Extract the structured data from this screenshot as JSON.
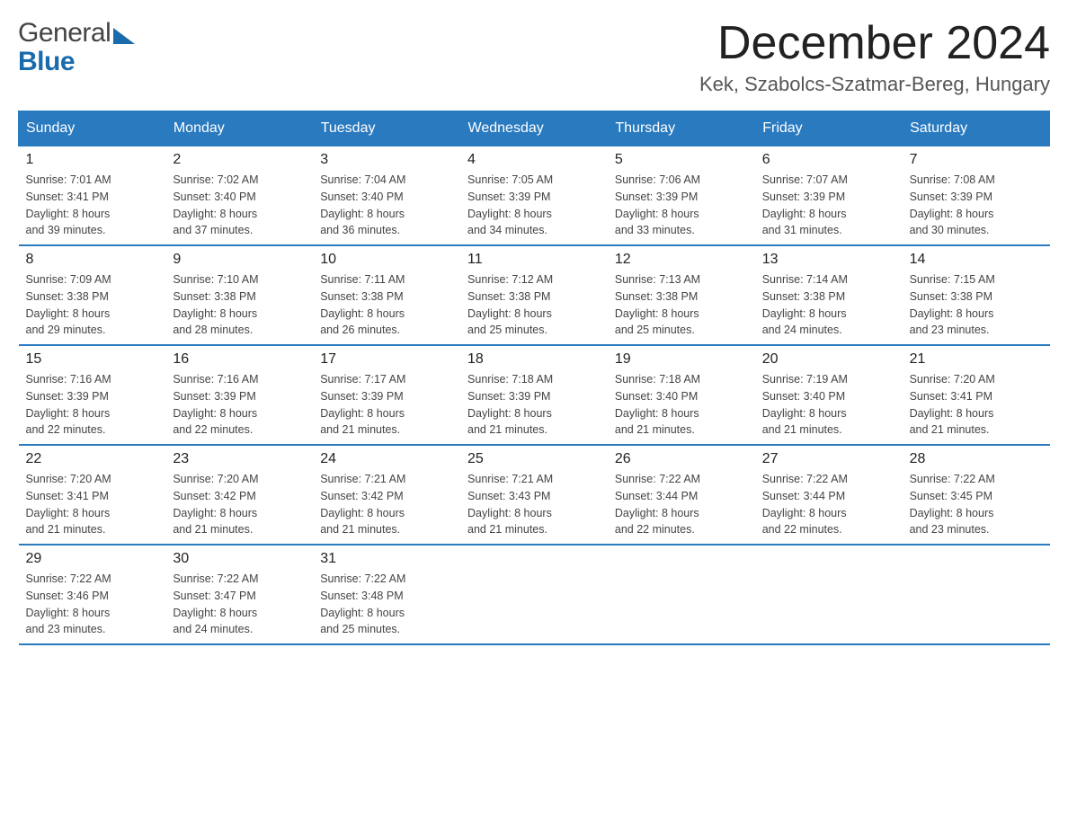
{
  "header": {
    "logo_general": "General",
    "logo_blue": "Blue",
    "month_title": "December 2024",
    "location": "Kek, Szabolcs-Szatmar-Bereg, Hungary"
  },
  "weekdays": [
    "Sunday",
    "Monday",
    "Tuesday",
    "Wednesday",
    "Thursday",
    "Friday",
    "Saturday"
  ],
  "weeks": [
    [
      {
        "day": "1",
        "sunrise": "7:01 AM",
        "sunset": "3:41 PM",
        "daylight": "8 hours and 39 minutes."
      },
      {
        "day": "2",
        "sunrise": "7:02 AM",
        "sunset": "3:40 PM",
        "daylight": "8 hours and 37 minutes."
      },
      {
        "day": "3",
        "sunrise": "7:04 AM",
        "sunset": "3:40 PM",
        "daylight": "8 hours and 36 minutes."
      },
      {
        "day": "4",
        "sunrise": "7:05 AM",
        "sunset": "3:39 PM",
        "daylight": "8 hours and 34 minutes."
      },
      {
        "day": "5",
        "sunrise": "7:06 AM",
        "sunset": "3:39 PM",
        "daylight": "8 hours and 33 minutes."
      },
      {
        "day": "6",
        "sunrise": "7:07 AM",
        "sunset": "3:39 PM",
        "daylight": "8 hours and 31 minutes."
      },
      {
        "day": "7",
        "sunrise": "7:08 AM",
        "sunset": "3:39 PM",
        "daylight": "8 hours and 30 minutes."
      }
    ],
    [
      {
        "day": "8",
        "sunrise": "7:09 AM",
        "sunset": "3:38 PM",
        "daylight": "8 hours and 29 minutes."
      },
      {
        "day": "9",
        "sunrise": "7:10 AM",
        "sunset": "3:38 PM",
        "daylight": "8 hours and 28 minutes."
      },
      {
        "day": "10",
        "sunrise": "7:11 AM",
        "sunset": "3:38 PM",
        "daylight": "8 hours and 26 minutes."
      },
      {
        "day": "11",
        "sunrise": "7:12 AM",
        "sunset": "3:38 PM",
        "daylight": "8 hours and 25 minutes."
      },
      {
        "day": "12",
        "sunrise": "7:13 AM",
        "sunset": "3:38 PM",
        "daylight": "8 hours and 25 minutes."
      },
      {
        "day": "13",
        "sunrise": "7:14 AM",
        "sunset": "3:38 PM",
        "daylight": "8 hours and 24 minutes."
      },
      {
        "day": "14",
        "sunrise": "7:15 AM",
        "sunset": "3:38 PM",
        "daylight": "8 hours and 23 minutes."
      }
    ],
    [
      {
        "day": "15",
        "sunrise": "7:16 AM",
        "sunset": "3:39 PM",
        "daylight": "8 hours and 22 minutes."
      },
      {
        "day": "16",
        "sunrise": "7:16 AM",
        "sunset": "3:39 PM",
        "daylight": "8 hours and 22 minutes."
      },
      {
        "day": "17",
        "sunrise": "7:17 AM",
        "sunset": "3:39 PM",
        "daylight": "8 hours and 21 minutes."
      },
      {
        "day": "18",
        "sunrise": "7:18 AM",
        "sunset": "3:39 PM",
        "daylight": "8 hours and 21 minutes."
      },
      {
        "day": "19",
        "sunrise": "7:18 AM",
        "sunset": "3:40 PM",
        "daylight": "8 hours and 21 minutes."
      },
      {
        "day": "20",
        "sunrise": "7:19 AM",
        "sunset": "3:40 PM",
        "daylight": "8 hours and 21 minutes."
      },
      {
        "day": "21",
        "sunrise": "7:20 AM",
        "sunset": "3:41 PM",
        "daylight": "8 hours and 21 minutes."
      }
    ],
    [
      {
        "day": "22",
        "sunrise": "7:20 AM",
        "sunset": "3:41 PM",
        "daylight": "8 hours and 21 minutes."
      },
      {
        "day": "23",
        "sunrise": "7:20 AM",
        "sunset": "3:42 PM",
        "daylight": "8 hours and 21 minutes."
      },
      {
        "day": "24",
        "sunrise": "7:21 AM",
        "sunset": "3:42 PM",
        "daylight": "8 hours and 21 minutes."
      },
      {
        "day": "25",
        "sunrise": "7:21 AM",
        "sunset": "3:43 PM",
        "daylight": "8 hours and 21 minutes."
      },
      {
        "day": "26",
        "sunrise": "7:22 AM",
        "sunset": "3:44 PM",
        "daylight": "8 hours and 22 minutes."
      },
      {
        "day": "27",
        "sunrise": "7:22 AM",
        "sunset": "3:44 PM",
        "daylight": "8 hours and 22 minutes."
      },
      {
        "day": "28",
        "sunrise": "7:22 AM",
        "sunset": "3:45 PM",
        "daylight": "8 hours and 23 minutes."
      }
    ],
    [
      {
        "day": "29",
        "sunrise": "7:22 AM",
        "sunset": "3:46 PM",
        "daylight": "8 hours and 23 minutes."
      },
      {
        "day": "30",
        "sunrise": "7:22 AM",
        "sunset": "3:47 PM",
        "daylight": "8 hours and 24 minutes."
      },
      {
        "day": "31",
        "sunrise": "7:22 AM",
        "sunset": "3:48 PM",
        "daylight": "8 hours and 25 minutes."
      },
      null,
      null,
      null,
      null
    ]
  ],
  "labels": {
    "sunrise_prefix": "Sunrise: ",
    "sunset_prefix": "Sunset: ",
    "daylight_prefix": "Daylight: "
  }
}
